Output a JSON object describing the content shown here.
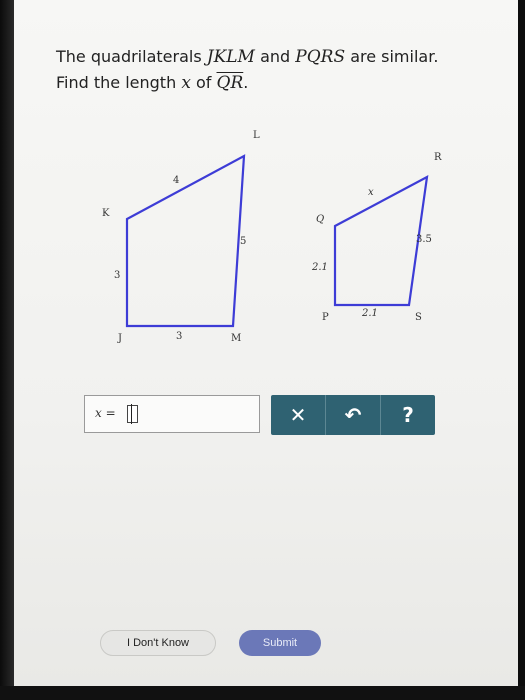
{
  "question": {
    "line1_prefix": "The quadrilaterals",
    "shape1": "JKLM",
    "line1_and": "and",
    "shape2": "PQRS",
    "line1_suffix": "are similar.",
    "line2_prefix": "Find the length",
    "var": "x",
    "line2_of": "of",
    "segment": "QR",
    "line2_end": "."
  },
  "figure": {
    "jklm": {
      "vertex_labels": {
        "J": "J",
        "K": "K",
        "L": "L",
        "M": "M"
      },
      "side_labels": {
        "KL": "4",
        "LM": "5",
        "JK": "3",
        "JM": "3"
      }
    },
    "pqrs": {
      "vertex_labels": {
        "P": "P",
        "Q": "Q",
        "R": "R",
        "S": "S"
      },
      "side_labels": {
        "QR": "x",
        "RS": "3.5",
        "PQ": "2.1",
        "PS": "2.1"
      }
    }
  },
  "answer": {
    "label": "x =",
    "value": ""
  },
  "toolbar": {
    "clear_symbol": "✕",
    "undo_symbol": "↶",
    "help_symbol": "?"
  },
  "buttons": {
    "dont_know": "I Don't Know",
    "submit": "Submit"
  },
  "colors": {
    "toolbar": "#2f6272",
    "shape_stroke": "#3d3cd6",
    "submit": "#6b78b8"
  }
}
